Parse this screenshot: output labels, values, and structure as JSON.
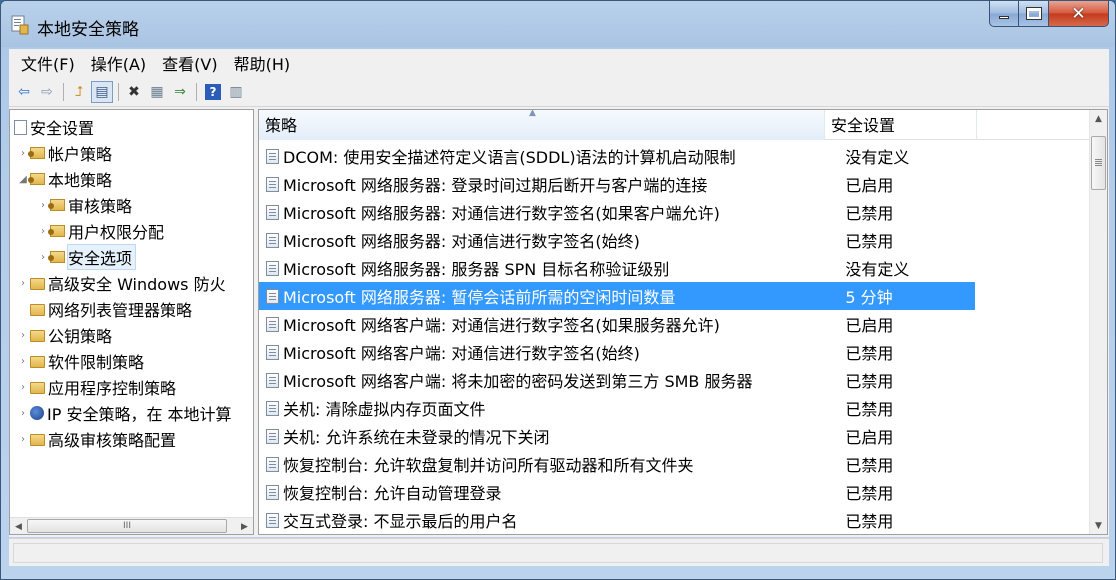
{
  "window": {
    "title": "本地安全策略",
    "icon": "local-security-policy-icon"
  },
  "menu": [
    {
      "label": "文件(F)"
    },
    {
      "label": "操作(A)"
    },
    {
      "label": "查看(V)"
    },
    {
      "label": "帮助(H)"
    }
  ],
  "toolbar": [
    {
      "icon": "back-arrow-icon",
      "glyph": "⇦"
    },
    {
      "icon": "forward-arrow-icon",
      "glyph": "⇨"
    },
    {
      "icon": "up-folder-icon",
      "glyph": "⮥"
    },
    {
      "icon": "show-hide-tree-icon",
      "glyph": "▤"
    },
    {
      "icon": "delete-icon",
      "glyph": "✖"
    },
    {
      "icon": "properties-icon",
      "glyph": "▦"
    },
    {
      "icon": "export-list-icon",
      "glyph": "⇒"
    },
    {
      "icon": "help-icon",
      "glyph": "?"
    },
    {
      "icon": "view-icon",
      "glyph": "▥"
    }
  ],
  "tree": {
    "root": "安全设置",
    "items": [
      {
        "label": "帐户策略",
        "arrow": "›",
        "icon": "folder-key"
      },
      {
        "label": "本地策略",
        "arrow": "◢",
        "icon": "folder-key"
      },
      {
        "label": "审核策略",
        "arrow": "›",
        "icon": "folder-key"
      },
      {
        "label": "用户权限分配",
        "arrow": "›",
        "icon": "folder-key"
      },
      {
        "label": "安全选项",
        "arrow": "›",
        "icon": "folder-key"
      },
      {
        "label": "高级安全 Windows 防火",
        "arrow": "›",
        "icon": "folder"
      },
      {
        "label": "网络列表管理器策略",
        "arrow": "",
        "icon": "folder"
      },
      {
        "label": "公钥策略",
        "arrow": "›",
        "icon": "folder"
      },
      {
        "label": "软件限制策略",
        "arrow": "›",
        "icon": "folder"
      },
      {
        "label": "应用程序控制策略",
        "arrow": "›",
        "icon": "folder"
      },
      {
        "label": "IP 安全策略，在 本地计算",
        "arrow": "›",
        "icon": "network"
      },
      {
        "label": "高级审核策略配置",
        "arrow": "›",
        "icon": "folder"
      }
    ],
    "scroll_thumb_label": "III"
  },
  "list": {
    "columns": {
      "policy": "策略",
      "setting": "安全设置"
    },
    "rows": [
      {
        "policy": "DCOM: 使用安全描述符定义语言(SDDL)语法的计算机启动限制",
        "setting": "没有定义"
      },
      {
        "policy": "Microsoft 网络服务器: 登录时间过期后断开与客户端的连接",
        "setting": "已启用"
      },
      {
        "policy": "Microsoft 网络服务器: 对通信进行数字签名(如果客户端允许)",
        "setting": "已禁用"
      },
      {
        "policy": "Microsoft 网络服务器: 对通信进行数字签名(始终)",
        "setting": "已禁用"
      },
      {
        "policy": "Microsoft 网络服务器: 服务器 SPN 目标名称验证级别",
        "setting": "没有定义"
      },
      {
        "policy": "Microsoft 网络服务器: 暂停会话前所需的空闲时间数量",
        "setting": "5 分钟",
        "selected": true
      },
      {
        "policy": "Microsoft 网络客户端: 对通信进行数字签名(如果服务器允许)",
        "setting": "已启用"
      },
      {
        "policy": "Microsoft 网络客户端: 对通信进行数字签名(始终)",
        "setting": "已禁用"
      },
      {
        "policy": "Microsoft 网络客户端: 将未加密的密码发送到第三方 SMB 服务器",
        "setting": "已禁用"
      },
      {
        "policy": "关机: 清除虚拟内存页面文件",
        "setting": "已禁用"
      },
      {
        "policy": "关机: 允许系统在未登录的情况下关闭",
        "setting": "已启用"
      },
      {
        "policy": "恢复控制台: 允许软盘复制并访问所有驱动器和所有文件夹",
        "setting": "已禁用"
      },
      {
        "policy": "恢复控制台: 允许自动管理登录",
        "setting": "已禁用"
      },
      {
        "policy": "交互式登录: 不显示最后的用户名",
        "setting": "已禁用"
      }
    ]
  }
}
